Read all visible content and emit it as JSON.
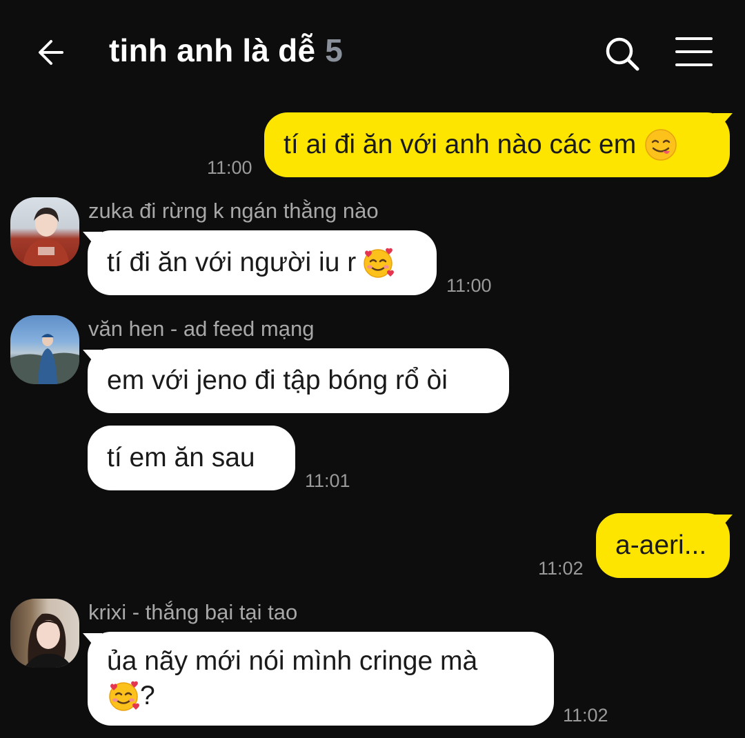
{
  "header": {
    "title": "tinh anh là dễ",
    "member_count": "5",
    "back_icon": "arrow-left-icon",
    "search_icon": "search-icon",
    "menu_icon": "hamburger-menu-icon"
  },
  "colors": {
    "background": "#0d0d0d",
    "my_bubble": "#fee500",
    "their_bubble": "#ffffff",
    "timestamp": "#9a9a9a",
    "sender_name": "#a8a8a8"
  },
  "messages": [
    {
      "text": "tí ai đi ăn với anh nào các em",
      "emoji": "face-savoring-food-emoji",
      "time": "11:00",
      "mine": true
    },
    {
      "sender": "zuka đi rừng k ngán thằng nào",
      "text": "tí đi ăn với người iu r",
      "emoji": "smiling-face-with-hearts-emoji",
      "time": "11:00"
    },
    {
      "sender": "văn hen - ad feed mạng",
      "text": "em với jeno đi tập bóng rổ òi"
    },
    {
      "text": "tí em ăn sau",
      "time": "11:01"
    },
    {
      "text": "a-aeri...",
      "time": "11:02",
      "mine": true
    },
    {
      "sender": "krixi - thắng bại tại tao",
      "text_line1": "ủa nãy mới nói mình cringe mà",
      "emoji": "smiling-face-with-hearts-emoji",
      "text_line2": "?",
      "time": "11:02"
    }
  ]
}
